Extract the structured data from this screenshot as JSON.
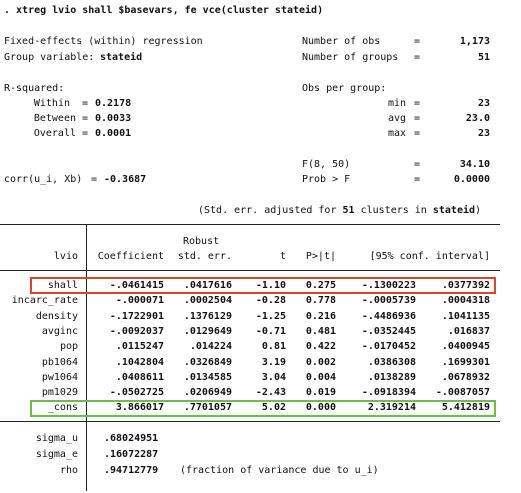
{
  "command": ". xtreg lvio shall $basevars, fe vce(cluster stateid)",
  "header": {
    "title": "Fixed-effects (within) regression",
    "group_label": "Group variable:",
    "group_var": "stateid",
    "nobs_label": "Number of obs",
    "nobs_eq": "=",
    "nobs": "1,173",
    "ngroups_label": "Number of groups",
    "ngroups_eq": "=",
    "ngroups": "51",
    "rsq_label": "R-squared:",
    "rsq_within_label": "Within",
    "rsq_within_eq": "=",
    "rsq_within": "0.2178",
    "rsq_between_label": "Between",
    "rsq_between_eq": "=",
    "rsq_between": "0.0033",
    "rsq_overall_label": "Overall",
    "rsq_overall_eq": "=",
    "rsq_overall": "0.0001",
    "obspg_label": "Obs per group:",
    "min_label": "min",
    "min_eq": "=",
    "min": "23",
    "avg_label": "avg",
    "avg_eq": "=",
    "avg": "23.0",
    "max_label": "max",
    "max_eq": "=",
    "max": "23",
    "f_label": "F(8, 50)",
    "f_eq": "=",
    "f": "34.10",
    "corr_label": "corr(u_i, Xb)",
    "corr_eq": "=",
    "corr": "-0.3687",
    "probf_label": "Prob > F",
    "probf_eq": "=",
    "probf": "0.0000",
    "adjusted_pre": "(Std. err. adjusted for",
    "adjusted_n": "51",
    "adjusted_mid": "clusters in",
    "adjusted_var": "stateid",
    "adjusted_post": ")"
  },
  "table": {
    "robust_label": "Robust",
    "depvar": "lvio",
    "col_coef": "Coefficient",
    "col_se": "std. err.",
    "col_t": "t",
    "col_p": "P>|t|",
    "col_ci": "[95% conf. interval]",
    "rows": [
      {
        "var": "shall",
        "coef": "-.0461415",
        "se": ".0417616",
        "t": "-1.10",
        "p": "0.275",
        "lo": "-.1300223",
        "hi": ".0377392"
      },
      {
        "var": "incarc_rate",
        "coef": "-.000071",
        "se": ".0002504",
        "t": "-0.28",
        "p": "0.778",
        "lo": "-.0005739",
        "hi": ".0004318"
      },
      {
        "var": "density",
        "coef": "-.1722901",
        "se": ".1376129",
        "t": "-1.25",
        "p": "0.216",
        "lo": "-.4486936",
        "hi": ".1041135"
      },
      {
        "var": "avginc",
        "coef": "-.0092037",
        "se": ".0129649",
        "t": "-0.71",
        "p": "0.481",
        "lo": "-.0352445",
        "hi": ".016837"
      },
      {
        "var": "pop",
        "coef": ".0115247",
        "se": ".014224",
        "t": "0.81",
        "p": "0.422",
        "lo": "-.0170452",
        "hi": ".0400945"
      },
      {
        "var": "pb1064",
        "coef": ".1042804",
        "se": ".0326849",
        "t": "3.19",
        "p": "0.002",
        "lo": ".0386308",
        "hi": ".1699301"
      },
      {
        "var": "pw1064",
        "coef": ".0408611",
        "se": ".0134585",
        "t": "3.04",
        "p": "0.004",
        "lo": ".0138289",
        "hi": ".0678932"
      },
      {
        "var": "pm1029",
        "coef": "-.0502725",
        "se": ".0206949",
        "t": "-2.43",
        "p": "0.019",
        "lo": "-.0918394",
        "hi": "-.0087057"
      },
      {
        "var": "_cons",
        "coef": "3.866017",
        "se": ".7701057",
        "t": "5.02",
        "p": "0.000",
        "lo": "2.319214",
        "hi": "5.412819"
      }
    ],
    "sigma_u_label": "sigma_u",
    "sigma_u": ".68024951",
    "sigma_e_label": "sigma_e",
    "sigma_e": ".16072287",
    "rho_label": "rho",
    "rho": ".94712779",
    "rho_note": "(fraction of variance due to u_i)"
  },
  "highlights": {
    "shall_color": "#e0452a",
    "cons_color": "#6cbf45"
  }
}
